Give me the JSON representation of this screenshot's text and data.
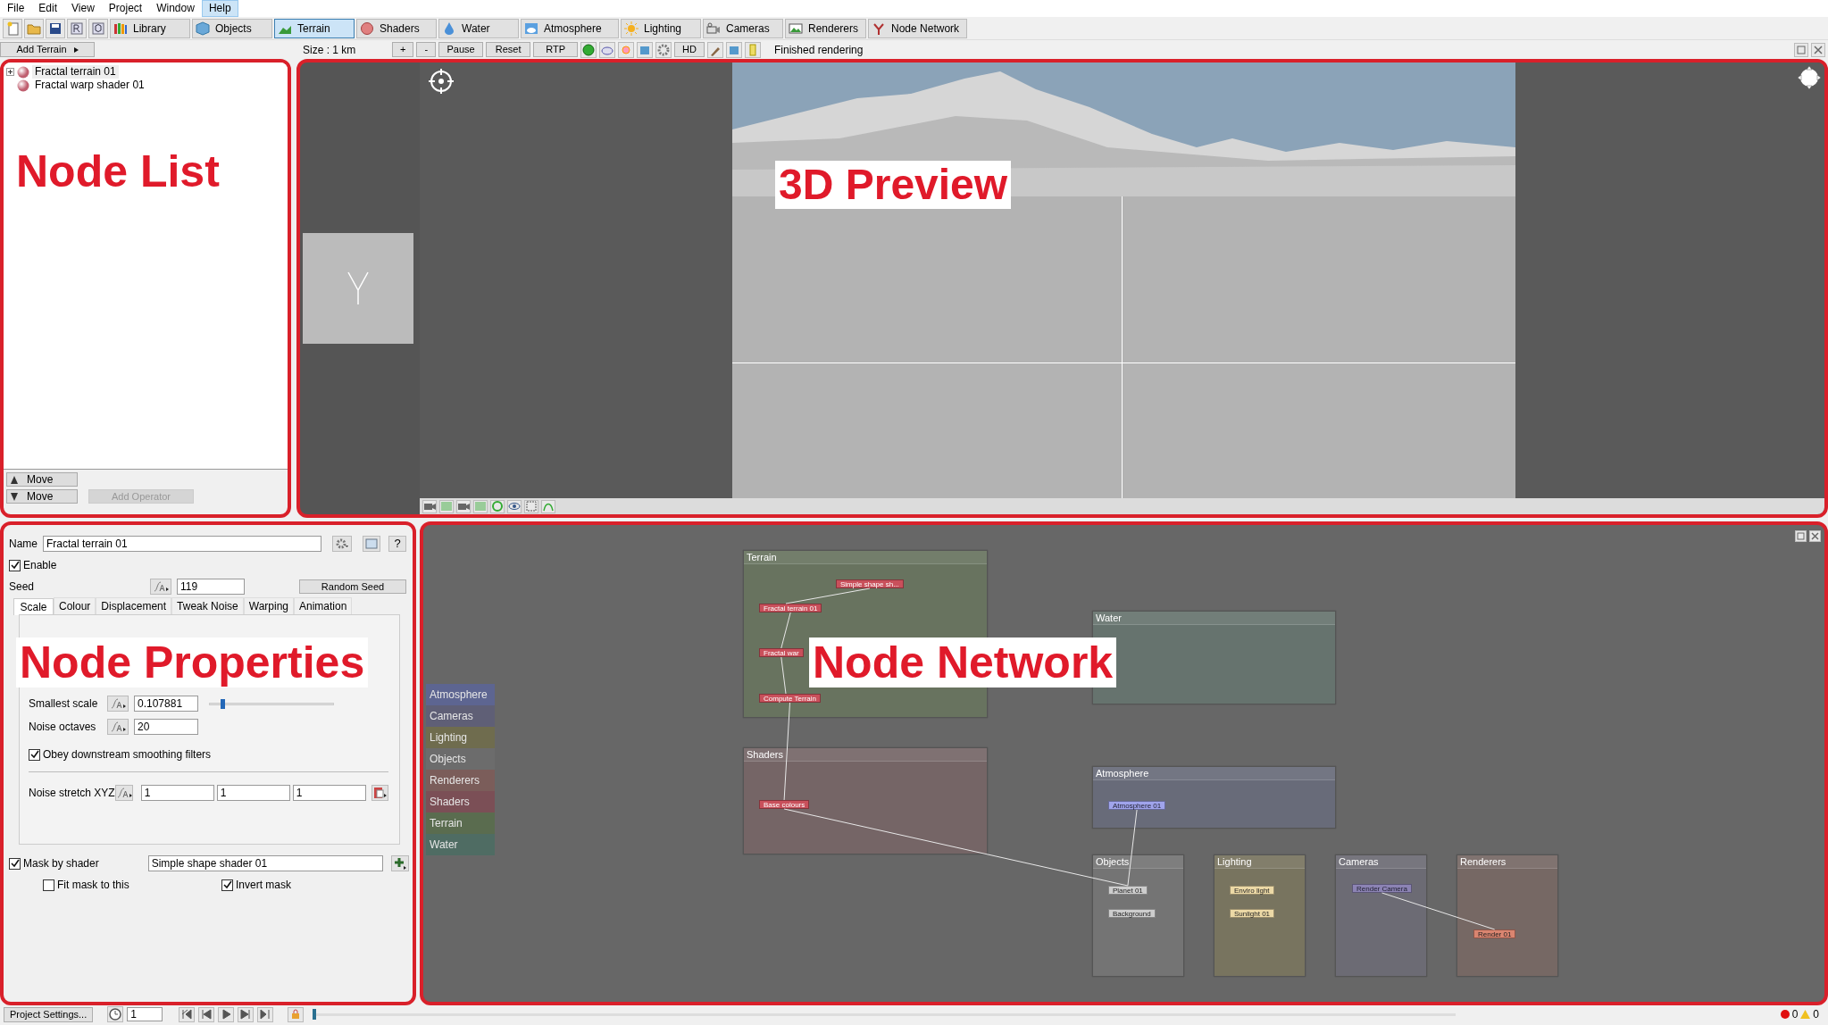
{
  "menu": [
    {
      "label": "File",
      "selected": false
    },
    {
      "label": "Edit",
      "selected": false
    },
    {
      "label": "View",
      "selected": false
    },
    {
      "label": "Project",
      "selected": false
    },
    {
      "label": "Window",
      "selected": false
    },
    {
      "label": "Help",
      "selected": true
    }
  ],
  "toolbar": {
    "tools": [
      {
        "label": "Library",
        "selected": false
      },
      {
        "label": "Objects",
        "selected": false
      },
      {
        "label": "Terrain",
        "selected": true
      },
      {
        "label": "Shaders",
        "selected": false
      },
      {
        "label": "Water",
        "selected": false
      },
      {
        "label": "Atmosphere",
        "selected": false
      },
      {
        "label": "Lighting",
        "selected": false
      },
      {
        "label": "Cameras",
        "selected": false
      },
      {
        "label": "Renderers",
        "selected": false
      },
      {
        "label": "Node Network",
        "selected": false
      }
    ]
  },
  "render_bar": {
    "add_button": "Add Terrain",
    "size": "Size : 1 km",
    "buttons": [
      "+",
      "-",
      "Pause",
      "Reset",
      "RTP"
    ],
    "hd": "HD",
    "status": "Finished rendering"
  },
  "node_list": {
    "items": [
      {
        "label": "Fractal terrain 01",
        "selected": true
      },
      {
        "label": "Fractal warp shader 01",
        "selected": false
      }
    ],
    "move_up": "Move",
    "move_down": "Move",
    "add_operator": "Add Operator"
  },
  "annotations": [
    "Node List",
    "3D Preview",
    "Node Properties",
    "Node Network"
  ],
  "properties": {
    "name_label": "Name",
    "name_value": "Fractal terrain 01",
    "enable": {
      "label": "Enable",
      "checked": true
    },
    "seed_label": "Seed",
    "seed_value": "119",
    "random_seed": "Random Seed",
    "help": "?",
    "tabs": [
      {
        "label": "Scale",
        "selected": true
      },
      {
        "label": "Colour",
        "selected": false
      },
      {
        "label": "Displacement",
        "selected": false
      },
      {
        "label": "Tweak Noise",
        "selected": false
      },
      {
        "label": "Warping",
        "selected": false
      },
      {
        "label": "Animation",
        "selected": false
      }
    ],
    "smallest_scale": {
      "label": "Smallest scale",
      "value": "0.107881",
      "level": 0.1
    },
    "noise_octaves": {
      "label": "Noise octaves",
      "value": "20"
    },
    "obey": {
      "label": "Obey downstream smoothing filters",
      "checked": true
    },
    "noise_stretch": {
      "label": "Noise stretch XYZ",
      "values": [
        "1",
        "1",
        "1"
      ]
    },
    "mask": {
      "label": "Mask by shader",
      "checked": true,
      "value": "Simple shape shader 01"
    },
    "fit_mask": {
      "label": "Fit mask to this",
      "checked": false
    },
    "invert_mask": {
      "label": "Invert mask",
      "checked": true
    }
  },
  "network": {
    "palette": [
      {
        "label": "Atmosphere",
        "color": "#5d6591"
      },
      {
        "label": "Cameras",
        "color": "#5f5f76"
      },
      {
        "label": "Lighting",
        "color": "#6f6c4e"
      },
      {
        "label": "Objects",
        "color": "#6c6c6c"
      },
      {
        "label": "Renderers",
        "color": "#7b5d5a"
      },
      {
        "label": "Shaders",
        "color": "#7b4f56"
      },
      {
        "label": "Terrain",
        "color": "#5a6c4f"
      },
      {
        "label": "Water",
        "color": "#4f6c63"
      }
    ],
    "groups": [
      {
        "title": "Terrain",
        "color": "#68735f",
        "nodes": [
          {
            "label": "Simple shape sh...",
            "color": "#c9505b"
          },
          {
            "label": "Fractal terrain 01",
            "color": "#c9505b"
          },
          {
            "label": "Fractal war",
            "color": "#c9505b"
          },
          {
            "label": "Compute Terrain",
            "color": "#c9505b"
          }
        ]
      },
      {
        "title": "Water",
        "color": "#66736e"
      },
      {
        "title": "Shaders",
        "color": "#756566",
        "nodes": [
          {
            "label": "Base colours",
            "color": "#c9505b"
          }
        ]
      },
      {
        "title": "Atmosphere",
        "color": "#686b79",
        "nodes": [
          {
            "label": "Atmosphere 01",
            "color": "#a0a4ec"
          }
        ]
      },
      {
        "title": "Objects",
        "color": "#747474",
        "nodes": [
          {
            "label": "Planet 01",
            "color": "#cdcdcd"
          },
          {
            "label": "Background",
            "color": "#cdcdcd"
          }
        ]
      },
      {
        "title": "Lighting",
        "color": "#78745f",
        "nodes": [
          {
            "label": "Enviro light",
            "color": "#ecd9a6"
          },
          {
            "label": "Sunlight 01",
            "color": "#ecd9a6"
          }
        ]
      },
      {
        "title": "Cameras",
        "color": "#6c6b74",
        "nodes": [
          {
            "label": "Render Camera",
            "color": "#8c83b4"
          }
        ]
      },
      {
        "title": "Renderers",
        "color": "#766864",
        "nodes": [
          {
            "label": "Render 01",
            "color": "#da8570"
          }
        ]
      }
    ]
  },
  "status_bar": {
    "project_settings": "Project Settings...",
    "frame": "1",
    "timeline": {
      "level": 0
    },
    "errors": "0",
    "warnings": "0"
  }
}
